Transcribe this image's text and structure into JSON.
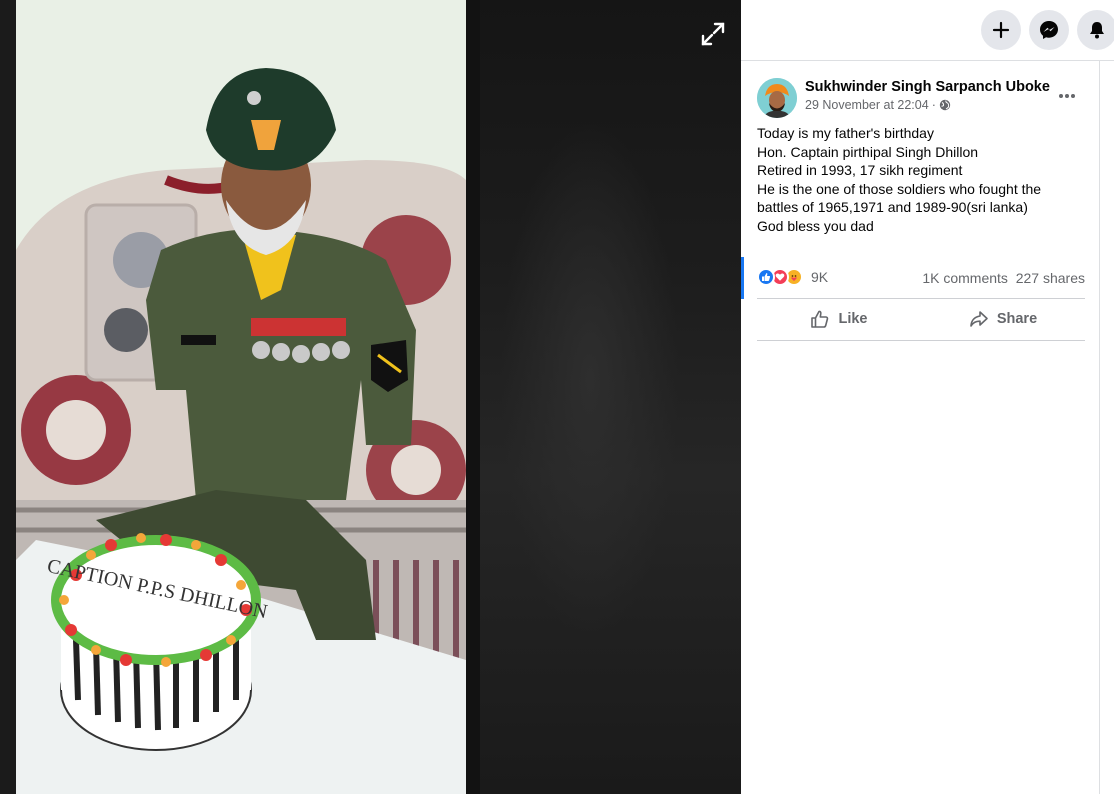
{
  "post": {
    "author": "Sukhwinder Singh Sarpanch Uboke",
    "timestamp": "29 November at 22:04",
    "separator": "·",
    "privacy_icon": "globe-icon",
    "text_lines": [
      "Today is my father's birthday",
      "Hon. Captain pirthipal Singh Dhillon",
      "Retired in 1993, 17 sikh regiment",
      "He is the one of those soldiers who fought the",
      "battles of 1965,1971 and 1989-90(sri lanka)",
      "God bless you dad"
    ],
    "reaction_count": "9K",
    "comments": "1K comments",
    "shares": "227 shares",
    "like_label": "Like",
    "share_label": "Share"
  },
  "photo": {
    "cake_text": "CAPTION P.P.S DHILLON"
  },
  "colors": {
    "accent": "#1877f2",
    "like_blue": "#1877f2",
    "love_red": "#f33e58",
    "care_yellow": "#f7b125"
  }
}
